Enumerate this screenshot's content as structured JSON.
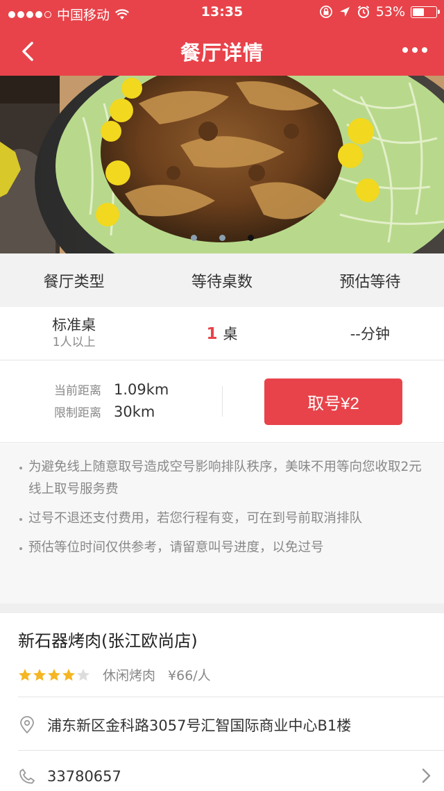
{
  "status_bar": {
    "carrier": "中国移动",
    "time": "13:35",
    "battery": "53%",
    "battery_level": 0.53
  },
  "nav": {
    "title": "餐厅详情",
    "back_icon": "chevron-left-icon",
    "more_icon": "more-dots-icon"
  },
  "banner": {
    "dot_count": 3,
    "active_index": 2
  },
  "queue": {
    "headers": [
      "餐厅类型",
      "等待桌数",
      "预估等待"
    ],
    "row": {
      "type": "标准桌",
      "capacity": "1人以上",
      "count": "1",
      "count_unit": "桌",
      "wait": "--分钟"
    }
  },
  "distance": {
    "current_label": "当前距离",
    "current_value": "1.09km",
    "limit_label": "限制距离",
    "limit_value": "30km",
    "take_number_label": "取号¥2"
  },
  "notes": [
    "为避免线上随意取号造成空号影响排队秩序，美味不用等向您收取2元线上取号服务费",
    "过号不退还支付费用，若您行程有变，可在到号前取消排队",
    "预估等位时间仅供参考，请留意叫号进度，以免过号"
  ],
  "restaurant": {
    "name": "新石器烤肉(张江欧尚店)",
    "stars": 4,
    "star_max": 5,
    "cuisine": "休闲烤肉",
    "price": "¥66/人",
    "address": "浦东新区金科路3057号汇智国际商业中心B1楼",
    "phone": "33780657"
  },
  "colors": {
    "brand": "#e8434a",
    "star": "#f5b623"
  }
}
